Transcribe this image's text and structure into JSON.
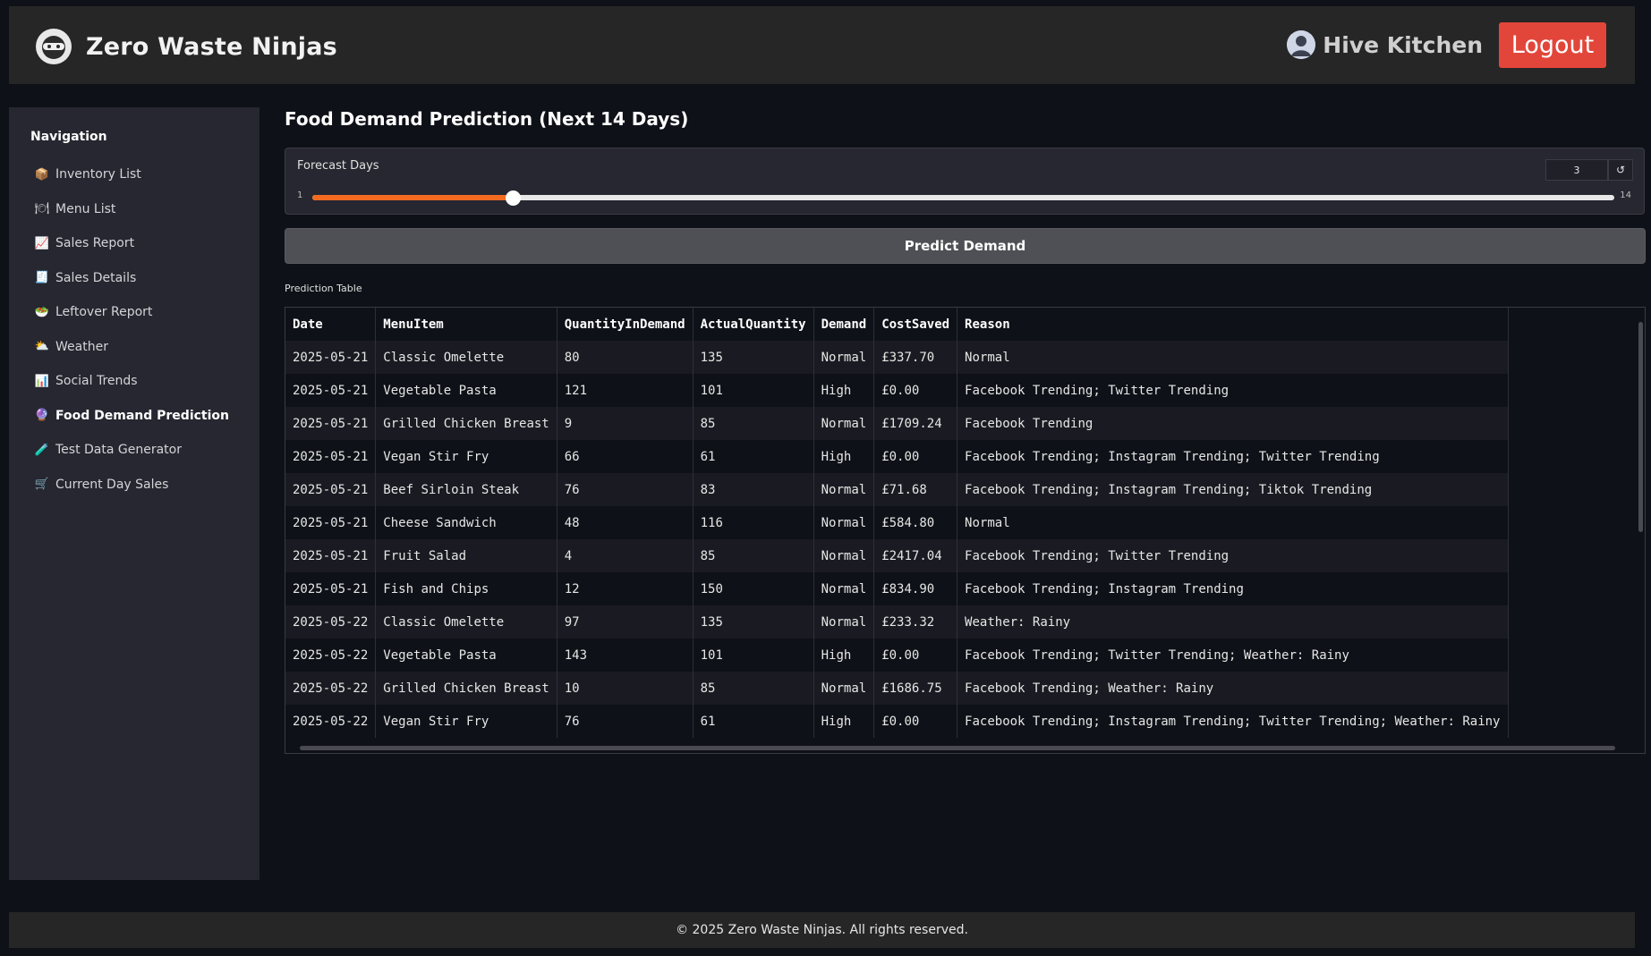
{
  "header": {
    "brand_name": "Zero Waste Ninjas",
    "user_name": "Hive Kitchen",
    "logout_label": "Logout"
  },
  "sidebar": {
    "title": "Navigation",
    "items": [
      {
        "icon": "📦",
        "icon_name": "package-icon",
        "label": "Inventory List",
        "active": false
      },
      {
        "icon": "🍽",
        "icon_name": "plate-icon",
        "label": "Menu List",
        "active": false
      },
      {
        "icon": "📈",
        "icon_name": "chart-up-icon",
        "label": "Sales Report",
        "active": false
      },
      {
        "icon": "🧾",
        "icon_name": "receipt-icon",
        "label": "Sales Details",
        "active": false
      },
      {
        "icon": "🥗",
        "icon_name": "salad-icon",
        "label": "Leftover Report",
        "active": false
      },
      {
        "icon": "⛅",
        "icon_name": "weather-icon",
        "label": "Weather",
        "active": false
      },
      {
        "icon": "📊",
        "icon_name": "bar-chart-icon",
        "label": "Social Trends",
        "active": false
      },
      {
        "icon": "🔮",
        "icon_name": "crystal-ball-icon",
        "label": "Food Demand Prediction",
        "active": true
      },
      {
        "icon": "🧪",
        "icon_name": "test-tube-icon",
        "label": "Test Data Generator",
        "active": false
      },
      {
        "icon": "🛒",
        "icon_name": "cart-icon",
        "label": "Current Day Sales",
        "active": false
      }
    ]
  },
  "main": {
    "title": "Food Demand Prediction (Next 14 Days)",
    "forecast": {
      "label": "Forecast Days",
      "value": "3",
      "min": "1",
      "max": "14",
      "level": 3
    },
    "predict_label": "Predict Demand",
    "table_label": "Prediction Table",
    "table": {
      "columns": [
        "Date",
        "MenuItem",
        "QuantityInDemand",
        "ActualQuantity",
        "Demand",
        "CostSaved",
        "Reason"
      ],
      "rows": [
        [
          "2025-05-21",
          "Classic Omelette",
          "80",
          "135",
          "Normal",
          "£337.70",
          "Normal"
        ],
        [
          "2025-05-21",
          "Vegetable Pasta",
          "121",
          "101",
          "High",
          "£0.00",
          "Facebook Trending; Twitter Trending"
        ],
        [
          "2025-05-21",
          "Grilled Chicken Breast",
          "9",
          "85",
          "Normal",
          "£1709.24",
          "Facebook Trending"
        ],
        [
          "2025-05-21",
          "Vegan Stir Fry",
          "66",
          "61",
          "High",
          "£0.00",
          "Facebook Trending; Instagram Trending; Twitter Trending"
        ],
        [
          "2025-05-21",
          "Beef Sirloin Steak",
          "76",
          "83",
          "Normal",
          "£71.68",
          "Facebook Trending; Instagram Trending; Tiktok Trending"
        ],
        [
          "2025-05-21",
          "Cheese Sandwich",
          "48",
          "116",
          "Normal",
          "£584.80",
          "Normal"
        ],
        [
          "2025-05-21",
          "Fruit Salad",
          "4",
          "85",
          "Normal",
          "£2417.04",
          "Facebook Trending; Twitter Trending"
        ],
        [
          "2025-05-21",
          "Fish and Chips",
          "12",
          "150",
          "Normal",
          "£834.90",
          "Facebook Trending; Instagram Trending"
        ],
        [
          "2025-05-22",
          "Classic Omelette",
          "97",
          "135",
          "Normal",
          "£233.32",
          "Weather: Rainy"
        ],
        [
          "2025-05-22",
          "Vegetable Pasta",
          "143",
          "101",
          "High",
          "£0.00",
          "Facebook Trending; Twitter Trending; Weather: Rainy"
        ],
        [
          "2025-05-22",
          "Grilled Chicken Breast",
          "10",
          "85",
          "Normal",
          "£1686.75",
          "Facebook Trending; Weather: Rainy"
        ],
        [
          "2025-05-22",
          "Vegan Stir Fry",
          "76",
          "61",
          "High",
          "£0.00",
          "Facebook Trending; Instagram Trending; Twitter Trending; Weather: Rainy"
        ]
      ]
    }
  },
  "footer": {
    "text": "© 2025 Zero Waste Ninjas. All rights reserved."
  },
  "colors": {
    "accent": "#f26b21",
    "logout": "#e2463a",
    "background": "#0e1117",
    "sidebar": "#262730"
  }
}
